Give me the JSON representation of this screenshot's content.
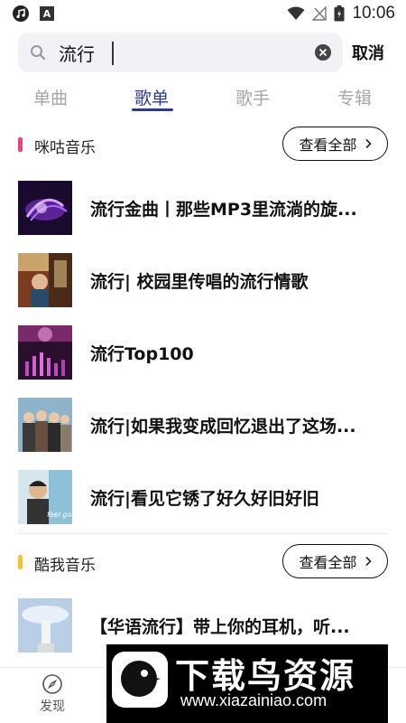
{
  "status_bar": {
    "time": "10:06",
    "a_icon_label": "A"
  },
  "search": {
    "query": "流行",
    "cancel_label": "取消"
  },
  "tabs": [
    {
      "label": "单曲",
      "active": false
    },
    {
      "label": "歌单",
      "active": true
    },
    {
      "label": "歌手",
      "active": false
    },
    {
      "label": "专辑",
      "active": false
    }
  ],
  "sections": [
    {
      "title": "咪咕音乐",
      "accent": "#e8457a",
      "view_all_label": "查看全部",
      "items": [
        {
          "title": "流行金曲丨那些MP3里流淌的旋..."
        },
        {
          "title": "流行| 校园里传唱的流行情歌"
        },
        {
          "title": "流行Top100"
        },
        {
          "title": "流行|如果我变成回忆退出了这场..."
        },
        {
          "title": "流行|看见它锈了好久好旧好旧"
        }
      ]
    },
    {
      "title": "酷我音乐",
      "accent": "#f4c430",
      "view_all_label": "查看全部",
      "items": [
        {
          "title": "【华语流行】带上你的耳机，听..."
        }
      ]
    }
  ],
  "bottom_nav": {
    "discover_label": "发现"
  },
  "watermark": {
    "title": "下载鸟资源",
    "url": "www.xiazainiao.com"
  },
  "colors": {
    "accent_blue": "#2f3a8f",
    "tab_inactive": "#a2a6ad"
  }
}
